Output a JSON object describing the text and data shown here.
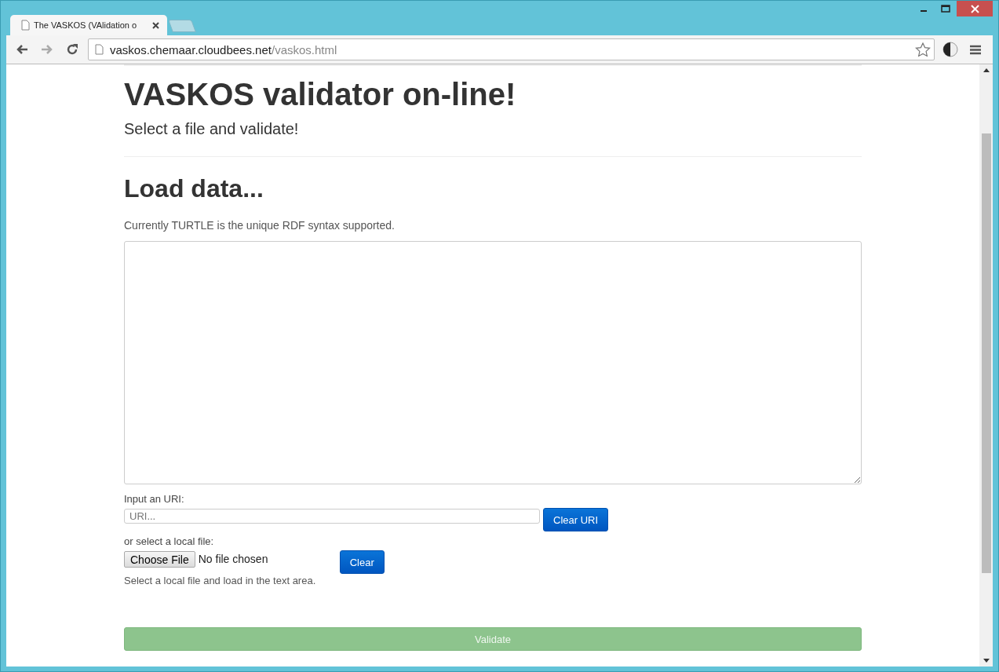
{
  "browser": {
    "tab_title": "The VASKOS (VAlidation o",
    "url_host": "vaskos.chemaar.cloudbees.net",
    "url_path": "/vaskos.html"
  },
  "page": {
    "title": "VASKOS validator on-line!",
    "subtitle": "Select a file and validate!",
    "section_title": "Load data...",
    "note": "Currently TURTLE is the unique RDF syntax supported.",
    "uri_label": "Input an URI:",
    "uri_field": {
      "placeholder": "URI..."
    },
    "clear_uri_button": "Clear URI",
    "file_label": "or select a local file:",
    "choose_file_button": "Choose File",
    "file_status": "No file chosen",
    "clear_button": "Clear",
    "file_help": "Select a local file and load in the text area.",
    "validate_button": {
      "label": "Validate",
      "disabled": true
    }
  }
}
